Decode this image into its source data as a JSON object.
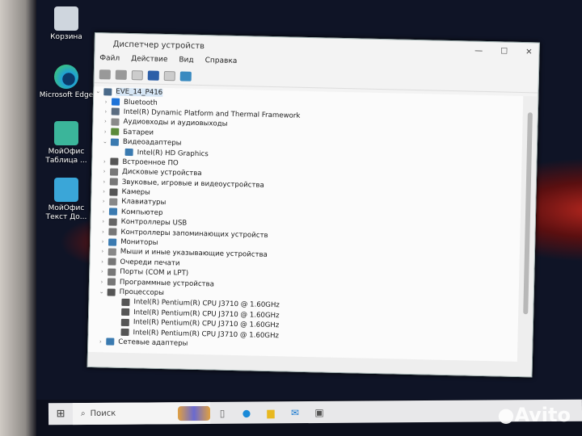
{
  "desktop": {
    "icons": [
      {
        "label": "Корзина"
      },
      {
        "label": "Microsoft Edge"
      },
      {
        "label": "МойОфис Таблица ..."
      },
      {
        "label": "МойОфис Текст До..."
      }
    ]
  },
  "window": {
    "title": "Диспетчер устройств",
    "menu": [
      "Файл",
      "Действие",
      "Вид",
      "Справка"
    ],
    "controls": [
      "—",
      "☐",
      "✕"
    ]
  },
  "tree": {
    "root": "EVE_14_P416",
    "items": [
      {
        "label": "Bluetooth",
        "chev": "›",
        "level": 1,
        "color": "#1e73d8"
      },
      {
        "label": "Intel(R) Dynamic Platform and Thermal Framework",
        "chev": "›",
        "level": 1,
        "color": "#5a6c80"
      },
      {
        "label": "Аудиовходы и аудиовыходы",
        "chev": "›",
        "level": 1,
        "color": "#8a8a8a"
      },
      {
        "label": "Батареи",
        "chev": "›",
        "level": 1,
        "color": "#5a8a3a"
      },
      {
        "label": "Видеоадаптеры",
        "chev": "⌄",
        "level": 1,
        "color": "#3a7ab0"
      },
      {
        "label": "Intel(R) HD Graphics",
        "chev": "",
        "level": 2,
        "color": "#3a7ab0"
      },
      {
        "label": "Встроенное ПО",
        "chev": "›",
        "level": 1,
        "color": "#555"
      },
      {
        "label": "Дисковые устройства",
        "chev": "›",
        "level": 1,
        "color": "#777"
      },
      {
        "label": "Звуковые, игровые и видеоустройства",
        "chev": "›",
        "level": 1,
        "color": "#777"
      },
      {
        "label": "Камеры",
        "chev": "›",
        "level": 1,
        "color": "#555"
      },
      {
        "label": "Клавиатуры",
        "chev": "›",
        "level": 1,
        "color": "#888"
      },
      {
        "label": "Компьютер",
        "chev": "›",
        "level": 1,
        "color": "#3a7ab0"
      },
      {
        "label": "Контроллеры USB",
        "chev": "›",
        "level": 1,
        "color": "#666"
      },
      {
        "label": "Контроллеры запоминающих устройств",
        "chev": "›",
        "level": 1,
        "color": "#777"
      },
      {
        "label": "Мониторы",
        "chev": "›",
        "level": 1,
        "color": "#3a7ab0"
      },
      {
        "label": "Мыши и иные указывающие устройства",
        "chev": "›",
        "level": 1,
        "color": "#888"
      },
      {
        "label": "Очереди печати",
        "chev": "›",
        "level": 1,
        "color": "#777"
      },
      {
        "label": "Порты (COM и LPT)",
        "chev": "›",
        "level": 1,
        "color": "#777"
      },
      {
        "label": "Программные устройства",
        "chev": "›",
        "level": 1,
        "color": "#777"
      },
      {
        "label": "Процессоры",
        "chev": "⌄",
        "level": 1,
        "color": "#555"
      },
      {
        "label": "Intel(R) Pentium(R) CPU  J3710  @ 1.60GHz",
        "chev": "",
        "level": 2,
        "color": "#555"
      },
      {
        "label": "Intel(R) Pentium(R) CPU  J3710  @ 1.60GHz",
        "chev": "",
        "level": 2,
        "color": "#555"
      },
      {
        "label": "Intel(R) Pentium(R) CPU  J3710  @ 1.60GHz",
        "chev": "",
        "level": 2,
        "color": "#555"
      },
      {
        "label": "Intel(R) Pentium(R) CPU  J3710  @ 1.60GHz",
        "chev": "",
        "level": 2,
        "color": "#555"
      },
      {
        "label": "Сетевые адаптеры",
        "chev": "›",
        "level": 1,
        "color": "#3a7ab0"
      }
    ]
  },
  "taskbar": {
    "search_placeholder": "Поиск"
  },
  "watermark": "Avito"
}
